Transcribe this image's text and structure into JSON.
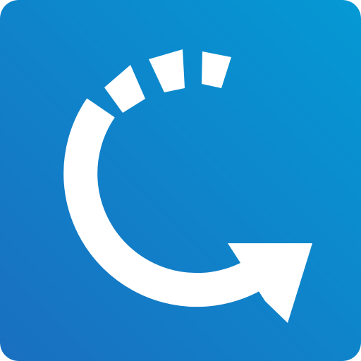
{
  "app_icon": {
    "icon_name": "refresh-arrow-icon",
    "colors": {
      "tile_gradient_start": "#1a6fc0",
      "tile_gradient_end": "#0499d4",
      "glyph": "#ffffff"
    }
  }
}
